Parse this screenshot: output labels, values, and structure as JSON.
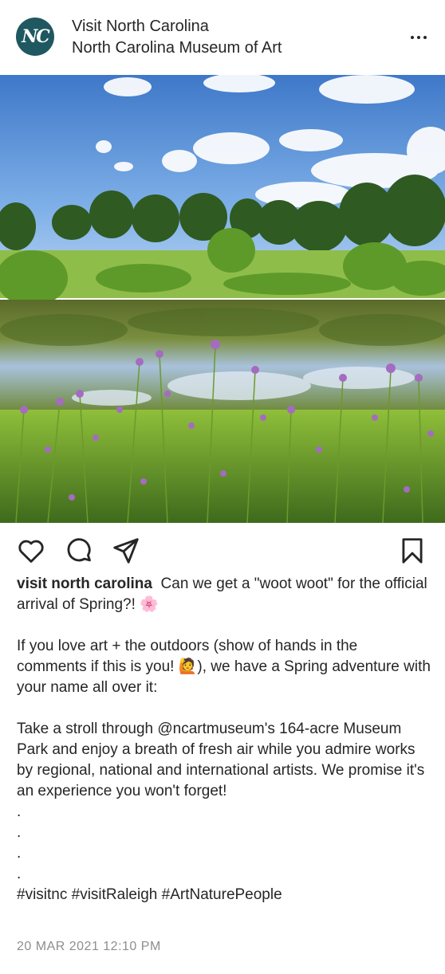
{
  "header": {
    "avatar_text": "NC",
    "account_name": "Visit North Carolina",
    "location": "North Carolina Museum of Art",
    "more_icon": "more-horizontal-icon"
  },
  "photo": {
    "description_icon": "landscape-photo"
  },
  "actions": {
    "like_icon": "heart-icon",
    "comment_icon": "comment-icon",
    "share_icon": "paper-plane-icon",
    "save_icon": "bookmark-icon"
  },
  "caption": {
    "username": "visit north carolina",
    "line1": "Can we get a \"woot woot\" for the official arrival of Spring?! 🌸",
    "para2": "If you love art + the outdoors (show of hands in the comments if this is you! 🙋), we have a Spring adventure with your name all over it:",
    "para3": "Take a stroll through @ncartmuseum's 164-acre Museum Park and enjoy a breath of fresh air while you admire works by regional, national and international artists. We promise it's an experience you won't forget!",
    "dots": [
      ".",
      ".",
      ".",
      "."
    ],
    "hashtags": "#visitnc #visitRaleigh #ArtNaturePeople"
  },
  "timestamp": "20 MAR 2021 12:10 PM",
  "colors": {
    "avatar_bg": "#1f5860",
    "text": "#262626",
    "muted": "#8e8e8e"
  }
}
